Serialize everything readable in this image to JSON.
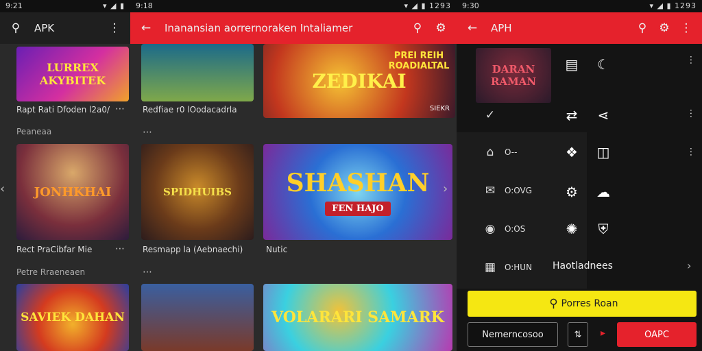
{
  "left": {
    "status_time": "9:21",
    "status_icons": "▾ ◢ ▮",
    "title": "APK",
    "tiles": [
      {
        "art_text": "LURREX AKYBITEK",
        "caption": "Rapt Rati Dfoden l2a0/"
      },
      {
        "art_text": "JONHKHAI",
        "caption": "Rect PraCibfar Mie"
      },
      {
        "art_text": "SAVIEK DAHAN",
        "caption": ""
      }
    ],
    "sections": [
      "Peaneaa",
      "Petre Rraeneaen"
    ]
  },
  "middle": {
    "status_time": "9:18",
    "status_icons": "▾ ◢ ▮ 1293",
    "title": "Inanansian aorrernoraken Intaliamer",
    "tiles": [
      {
        "art_text": "",
        "caption": "Redfiae r0 lOodacadrla"
      },
      {
        "art_text": "ZEDIKAI",
        "caption": "",
        "badge": "SIEKR"
      },
      {
        "art_text": "SPIDHUIBS",
        "caption": "Resmapp la (Aebnaechi)"
      },
      {
        "art_text": "SHASHAN",
        "caption": "Nutic",
        "subtitle": "FEN HAJO"
      },
      {
        "art_text": "",
        "caption": ""
      },
      {
        "art_text": "VOLARARI SAMARK",
        "caption": ""
      }
    ],
    "hero_top_right": "PREI REIH ROADIALTAL"
  },
  "right": {
    "status_time": "9:30",
    "status_icons": "▾ ◢ ▮ 1293",
    "title": "APH",
    "hero_text": "DARAN RAMAN",
    "drawer_items": [
      {
        "label": "",
        "icon": "check-icon"
      },
      {
        "label": "O--",
        "icon": "home-icon"
      },
      {
        "label": "O:OVG",
        "icon": "mail-icon"
      },
      {
        "label": "O:OS",
        "icon": "record-icon"
      },
      {
        "label": "O:HUN",
        "icon": "calendar-icon"
      }
    ],
    "menu_label": "Haotladnees",
    "search_button": "Porres Roan",
    "secondary_button": "Nemerncosoo",
    "primary_button": "OAPC"
  },
  "colors": {
    "accent_red": "#e5222c",
    "accent_yellow": "#f5e712"
  }
}
